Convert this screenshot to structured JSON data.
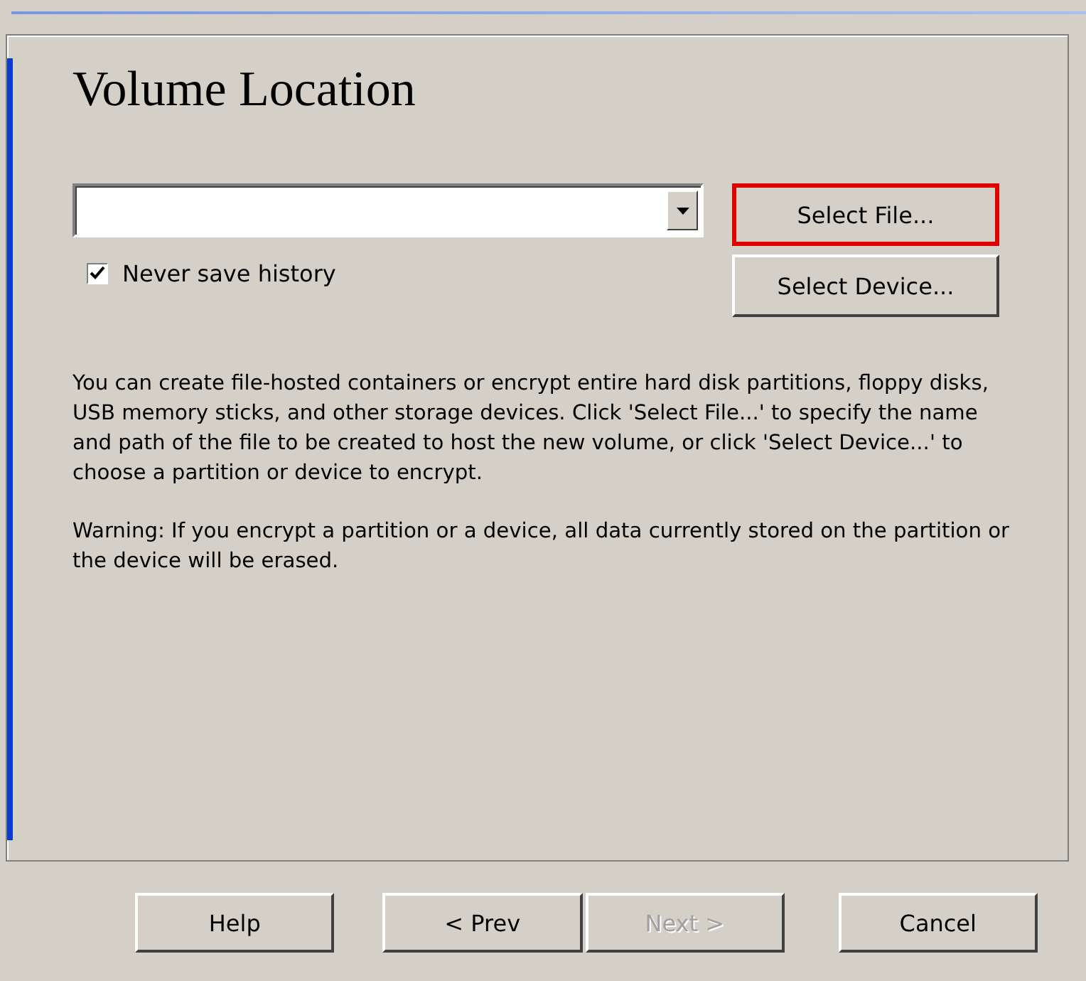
{
  "title": "Volume Location",
  "side_buttons": [
    {
      "label": "Select File...",
      "highlighted": true
    },
    {
      "label": "Select Device...",
      "highlighted": false
    }
  ],
  "never_save_history": {
    "label": "Never save history",
    "checked": true
  },
  "paragraphs": [
    "You can create file-hosted containers or encrypt entire hard disk partitions, floppy disks, USB memory sticks, and other storage devices. Click 'Select File...' to specify the name and path of the file to be created to host the new volume, or click 'Select Device...' to choose a partition or device to encrypt.",
    "Warning: If you encrypt a partition or a device, all data currently stored on the partition or the device will be erased."
  ],
  "buttons": [
    {
      "label": "Help",
      "disabled": false
    },
    {
      "label": "< Prev",
      "disabled": false
    },
    {
      "label": "Next >",
      "disabled": true
    },
    {
      "label": "Cancel",
      "disabled": false
    }
  ]
}
